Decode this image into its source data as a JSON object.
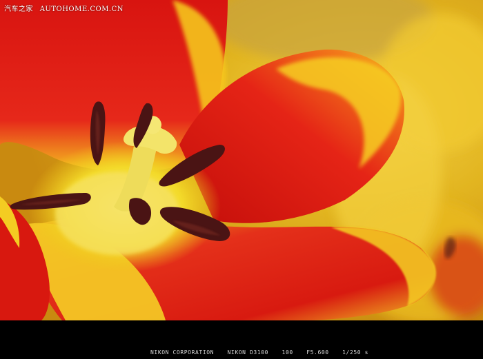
{
  "watermark": {
    "site_cn": "汽车之家",
    "site_en": "AUTOHOME.COM.CN"
  },
  "exif": {
    "maker": "NIKON CORPORATION",
    "model": "NIKON D3100",
    "iso": "100",
    "aperture": "F5.600",
    "shutter": "1/250 s"
  },
  "colors": {
    "petal_red": "#e21c12",
    "petal_yellow": "#f7d21c",
    "stamen": "#4a1414",
    "pistil": "#f2e06a",
    "background_blur": "#e0b820"
  }
}
